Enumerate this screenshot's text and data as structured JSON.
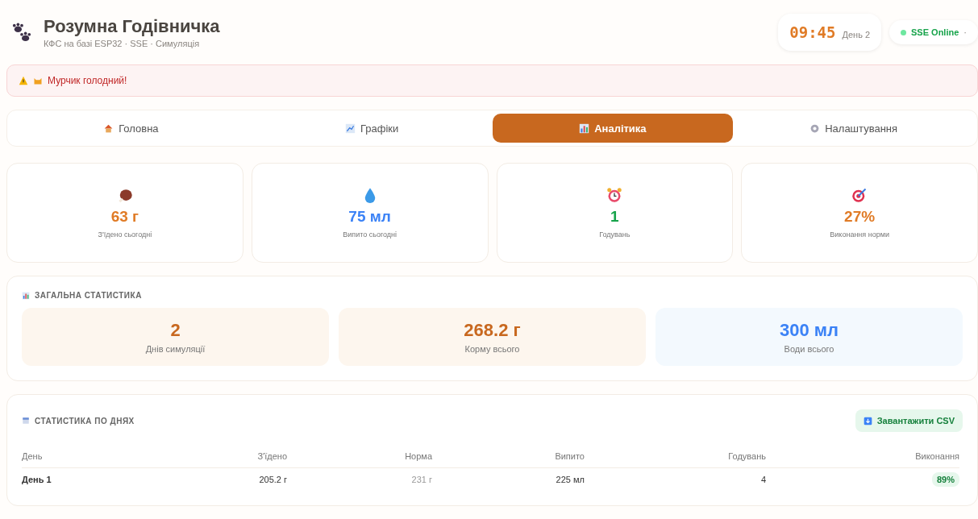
{
  "header": {
    "title": "Розумна Годівничка",
    "subtitle": "КФС на базі ESP32 · SSE · Симуляція",
    "clock": "09:45",
    "day": "День 2",
    "status": {
      "label": "SSE Online",
      "extra": "·",
      "online": true
    }
  },
  "alert": {
    "text": "Мурчик голодний!"
  },
  "tabs": [
    {
      "label": "Головна",
      "kind": "house",
      "selected": false
    },
    {
      "label": "Графіки",
      "kind": "chart",
      "selected": false
    },
    {
      "label": "Аналітика",
      "kind": "bars",
      "selected": true
    },
    {
      "label": "Налаштування",
      "kind": "gear",
      "selected": false
    }
  ],
  "stats": [
    {
      "kind": "meat",
      "value": "63 г",
      "label": "З'їдено сьогодні",
      "color": "#e07b26"
    },
    {
      "kind": "drop",
      "value": "75 мл",
      "label": "Випито сьогодні",
      "color": "#3b82f6"
    },
    {
      "kind": "alarm",
      "value": "1",
      "label": "Годувань",
      "color": "#16a34a"
    },
    {
      "kind": "target",
      "value": "27%",
      "label": "Виконання норми",
      "color": "#e07b26"
    }
  ],
  "summary": {
    "title": "ЗАГАЛЬНА СТАТИСТИКА",
    "tiles": [
      {
        "value": "2",
        "label": "Днів симуляції",
        "color": "#c8681f"
      },
      {
        "value": "268.2 г",
        "label": "Корму всього",
        "color": "#c8681f"
      },
      {
        "value": "300 мл",
        "label": "Води всього",
        "color": "#3b82f6"
      }
    ]
  },
  "daily": {
    "title": "СТАТИСТИКА ПО ДНЯХ",
    "button": "Завантажити CSV",
    "columns": [
      "День",
      "З'їдено",
      "Норма",
      "Випито",
      "Годувань",
      "Виконання"
    ],
    "rows": [
      {
        "cells": [
          "День 1",
          "205.2 г",
          "231 г",
          "225 мл",
          "4",
          "89%"
        ]
      }
    ]
  }
}
